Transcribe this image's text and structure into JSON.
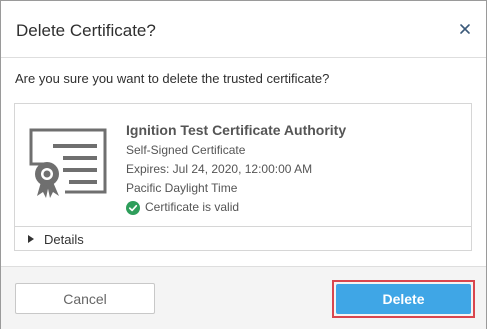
{
  "dialog": {
    "title": "Delete Certificate?",
    "question": "Are you sure you want to delete the trusted certificate?"
  },
  "certificate": {
    "name": "Ignition Test Certificate Authority",
    "type": "Self-Signed Certificate",
    "expires": "Expires: Jul 24, 2020, 12:00:00 AM",
    "timezone": "Pacific Daylight Time",
    "status": "Certificate is valid",
    "status_color": "#2e9e5b"
  },
  "details": {
    "label": "Details"
  },
  "footer": {
    "cancel_label": "Cancel",
    "delete_label": "Delete"
  },
  "colors": {
    "primary": "#3fa6e6",
    "highlight": "#d9464e"
  },
  "icons": {
    "close": "close-icon",
    "certificate": "certificate-icon",
    "valid": "check-circle-icon",
    "expand": "caret-right-icon"
  }
}
